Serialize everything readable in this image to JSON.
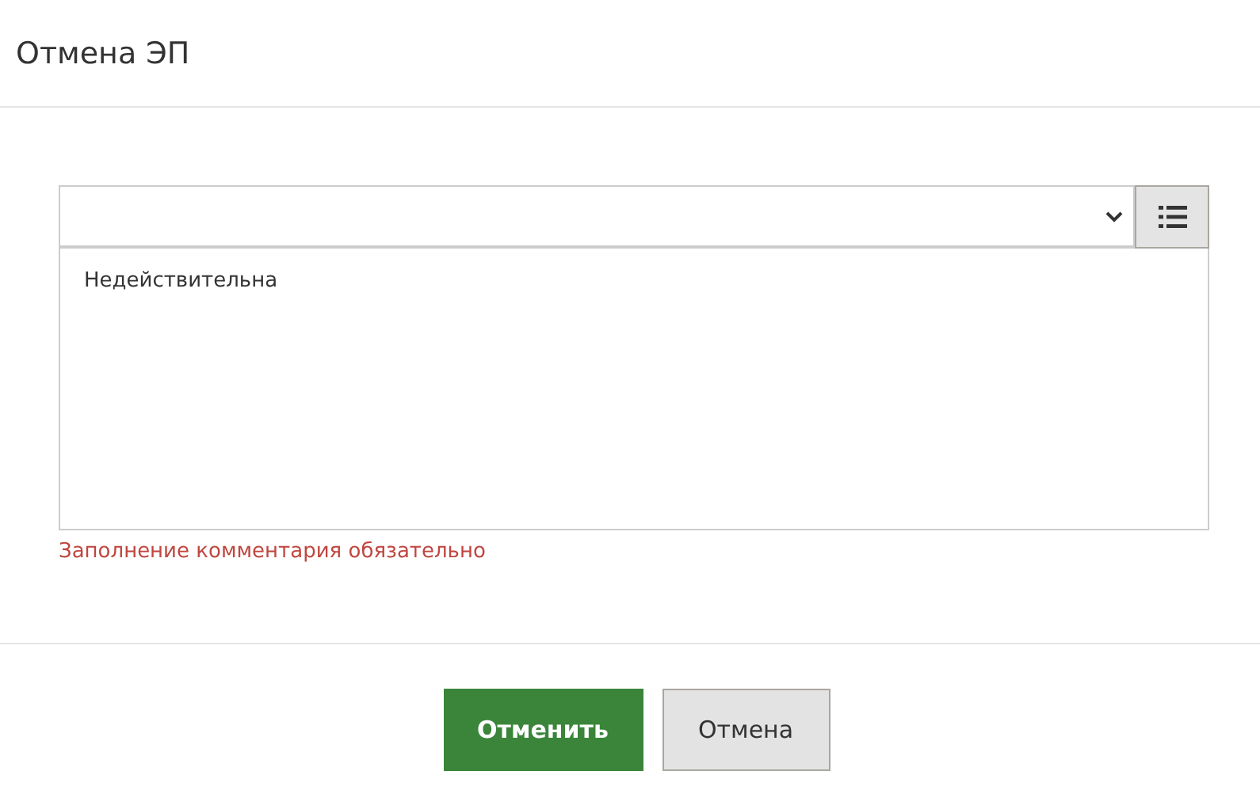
{
  "dialog": {
    "title": "Отмена ЭП"
  },
  "comment": {
    "value": "Недействительна"
  },
  "error": "Заполнение комментария обязательно",
  "buttons": [
    {
      "label": "Отменить",
      "kind": "primary"
    },
    {
      "label": "Отмена",
      "kind": "secondary"
    }
  ]
}
